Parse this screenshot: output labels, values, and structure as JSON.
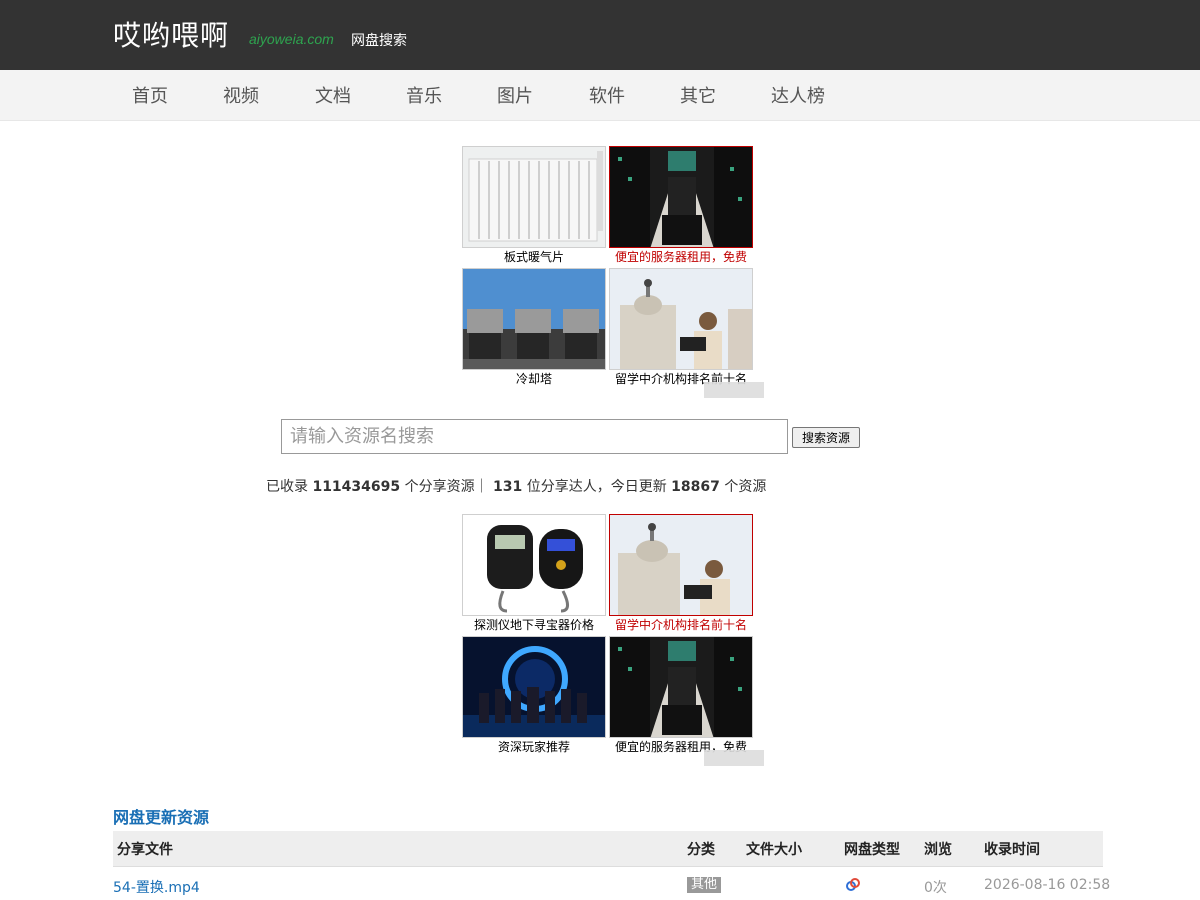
{
  "header": {
    "logo": "哎哟喂啊",
    "domain": "aiyoweia.com",
    "subtitle": "网盘搜索"
  },
  "nav": {
    "items": [
      "首页",
      "视频",
      "文档",
      "音乐",
      "图片",
      "软件",
      "其它",
      "达人榜"
    ]
  },
  "ads_top": [
    {
      "caption": "板式暖气片",
      "highlight": false,
      "image": "radiator-image"
    },
    {
      "caption": "便宜的服务器租用，免费",
      "highlight": true,
      "image": "server-rack-image"
    },
    {
      "caption": "冷却塔",
      "highlight": false,
      "image": "cooling-tower-image"
    },
    {
      "caption": "留学中介机构排名前十名",
      "highlight": false,
      "image": "woman-reading-image"
    }
  ],
  "ads_bottom": [
    {
      "caption": "探测仪地下寻宝器价格",
      "highlight": false,
      "image": "luggage-scale-image"
    },
    {
      "caption": "留学中介机构排名前十名",
      "highlight": true,
      "image": "woman-reading-image"
    },
    {
      "caption": "资深玩家推荐",
      "highlight": false,
      "image": "game-heroes-image"
    },
    {
      "caption": "便宜的服务器租用，免费",
      "highlight": false,
      "image": "server-rack-image"
    }
  ],
  "search": {
    "placeholder": "请输入资源名搜索",
    "value": "",
    "button_label": "搜索资源"
  },
  "stats": {
    "prefix": "已收录",
    "total": "111434695",
    "mid1": "个分享资源｜",
    "users": "131",
    "mid2": "位分享达人，今日更新",
    "today": "18867",
    "suffix": "个资源"
  },
  "table": {
    "title": "网盘更新资源",
    "headers": {
      "file": "分享文件",
      "category": "分类",
      "size": "文件大小",
      "type": "网盘类型",
      "views": "浏览",
      "time": "收录时间"
    },
    "rows": [
      {
        "file": "54-置换.mp4",
        "category": "其他",
        "size": "",
        "type_icon": "baidu-pan-icon",
        "views": "0次",
        "time": "2026-08-16 02:58"
      }
    ]
  },
  "colors": {
    "header_bg": "#333333",
    "nav_bg": "#f3f3f3",
    "domain_green": "#2ea44f",
    "link_blue": "#1a6fb5",
    "ad_highlight": "#c00000"
  }
}
